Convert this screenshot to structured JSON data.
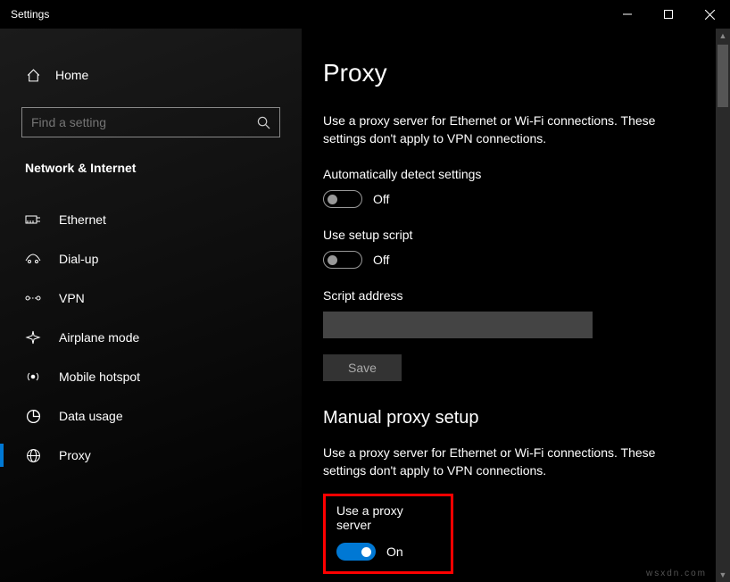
{
  "window": {
    "title": "Settings"
  },
  "sidebar": {
    "home": "Home",
    "search_placeholder": "Find a setting",
    "category": "Network & Internet",
    "items": [
      {
        "label": "Ethernet",
        "icon": "ethernet-icon"
      },
      {
        "label": "Dial-up",
        "icon": "dialup-icon"
      },
      {
        "label": "VPN",
        "icon": "vpn-icon"
      },
      {
        "label": "Airplane mode",
        "icon": "airplane-icon"
      },
      {
        "label": "Mobile hotspot",
        "icon": "hotspot-icon"
      },
      {
        "label": "Data usage",
        "icon": "datausage-icon"
      },
      {
        "label": "Proxy",
        "icon": "proxy-icon"
      }
    ],
    "active_index": 6
  },
  "main": {
    "title": "Proxy",
    "auto": {
      "desc": "Use a proxy server for Ethernet or Wi-Fi connections. These settings don't apply to VPN connections.",
      "detect_label": "Automatically detect settings",
      "detect_state": "Off",
      "script_label": "Use setup script",
      "script_state": "Off",
      "address_label": "Script address",
      "address_value": "",
      "save_label": "Save"
    },
    "manual": {
      "heading": "Manual proxy setup",
      "desc": "Use a proxy server for Ethernet or Wi-Fi connections. These settings don't apply to VPN connections.",
      "use_label": "Use a proxy server",
      "use_state": "On"
    }
  },
  "watermark": "wsxdn.com"
}
